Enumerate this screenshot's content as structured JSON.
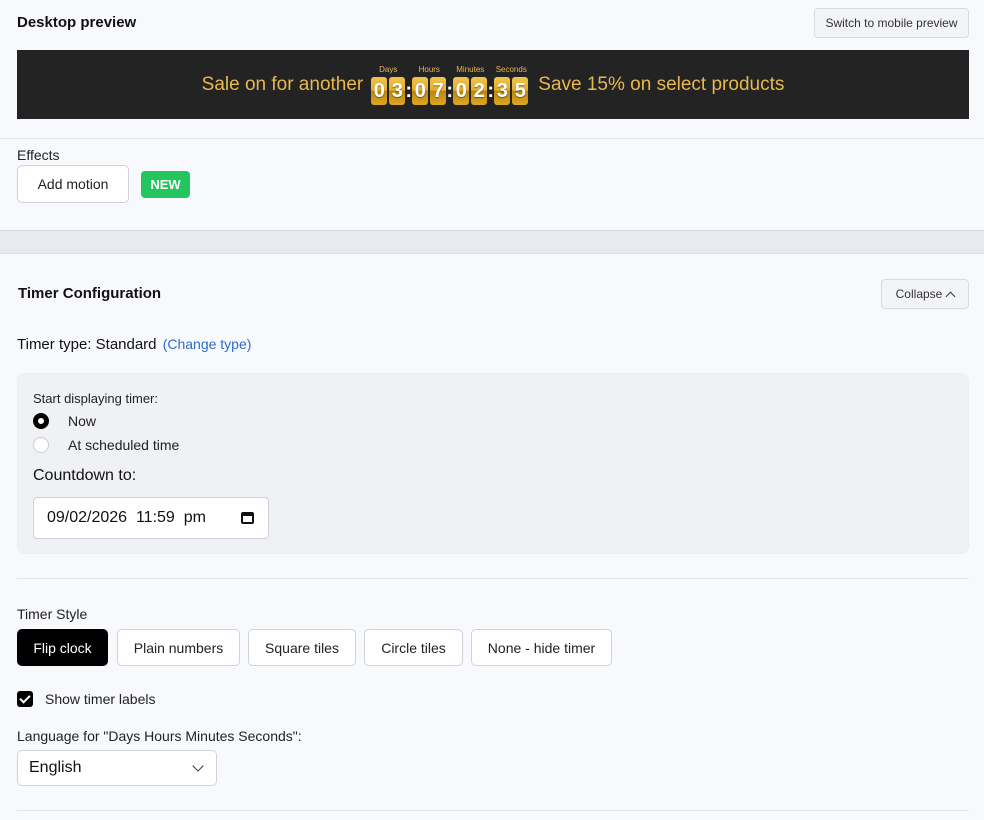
{
  "preview": {
    "title": "Desktop preview",
    "switch_button": "Switch to mobile preview"
  },
  "banner": {
    "text_before": "Sale on for another",
    "text_after": "Save 15% on select products",
    "colors": {
      "background": "#232323",
      "text": "#e8b84f",
      "tile": "#e3ad2a"
    },
    "timer": {
      "days": {
        "label": "Days",
        "d1": "0",
        "d2": "3"
      },
      "hours": {
        "label": "Hours",
        "d1": "0",
        "d2": "7"
      },
      "minutes": {
        "label": "Minutes",
        "d1": "0",
        "d2": "2"
      },
      "seconds": {
        "label": "Seconds",
        "d1": "3",
        "d2": "5"
      },
      "separator": ":"
    }
  },
  "effects": {
    "label": "Effects",
    "add_motion": "Add motion",
    "badge": "NEW",
    "badge_color": "#22c55e"
  },
  "config": {
    "title": "Timer Configuration",
    "collapse": "Collapse",
    "timer_type_label": "Timer type:",
    "timer_type_value": "Standard",
    "change_type": "(Change type)",
    "start_label": "Start displaying timer:",
    "options": {
      "now": "Now",
      "scheduled": "At scheduled time"
    },
    "selected_option": "Now",
    "countdown_label": "Countdown to:",
    "countdown_value": "09/02/2026  11:59  pm",
    "style_label": "Timer Style",
    "styles": {
      "flip": "Flip clock",
      "plain": "Plain numbers",
      "square": "Square tiles",
      "circle": "Circle tiles",
      "none": "None - hide timer"
    },
    "selected_style": "Flip clock",
    "show_labels": "Show timer labels",
    "show_labels_checked": true,
    "language_label": "Language for \"Days Hours Minutes Seconds\":",
    "language_value": "English"
  }
}
